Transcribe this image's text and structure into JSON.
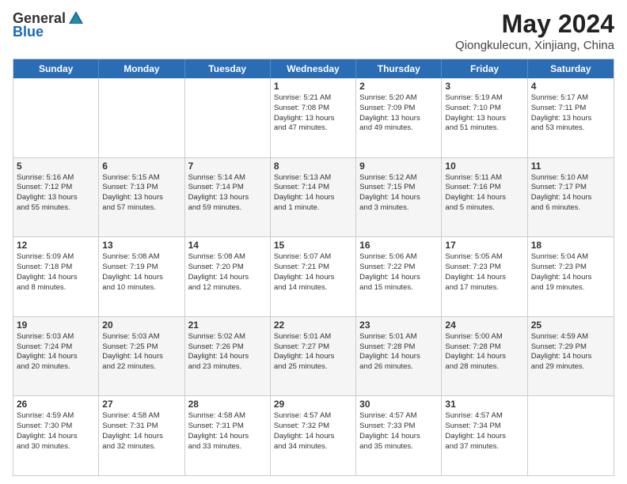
{
  "header": {
    "logo_general": "General",
    "logo_blue": "Blue",
    "title": "May 2024",
    "subtitle": "Qiongkulecun, Xinjiang, China"
  },
  "weekdays": [
    "Sunday",
    "Monday",
    "Tuesday",
    "Wednesday",
    "Thursday",
    "Friday",
    "Saturday"
  ],
  "rows": [
    [
      {
        "day": "",
        "lines": []
      },
      {
        "day": "",
        "lines": []
      },
      {
        "day": "",
        "lines": []
      },
      {
        "day": "1",
        "lines": [
          "Sunrise: 5:21 AM",
          "Sunset: 7:08 PM",
          "Daylight: 13 hours",
          "and 47 minutes."
        ]
      },
      {
        "day": "2",
        "lines": [
          "Sunrise: 5:20 AM",
          "Sunset: 7:09 PM",
          "Daylight: 13 hours",
          "and 49 minutes."
        ]
      },
      {
        "day": "3",
        "lines": [
          "Sunrise: 5:19 AM",
          "Sunset: 7:10 PM",
          "Daylight: 13 hours",
          "and 51 minutes."
        ]
      },
      {
        "day": "4",
        "lines": [
          "Sunrise: 5:17 AM",
          "Sunset: 7:11 PM",
          "Daylight: 13 hours",
          "and 53 minutes."
        ]
      }
    ],
    [
      {
        "day": "5",
        "lines": [
          "Sunrise: 5:16 AM",
          "Sunset: 7:12 PM",
          "Daylight: 13 hours",
          "and 55 minutes."
        ]
      },
      {
        "day": "6",
        "lines": [
          "Sunrise: 5:15 AM",
          "Sunset: 7:13 PM",
          "Daylight: 13 hours",
          "and 57 minutes."
        ]
      },
      {
        "day": "7",
        "lines": [
          "Sunrise: 5:14 AM",
          "Sunset: 7:14 PM",
          "Daylight: 13 hours",
          "and 59 minutes."
        ]
      },
      {
        "day": "8",
        "lines": [
          "Sunrise: 5:13 AM",
          "Sunset: 7:14 PM",
          "Daylight: 14 hours",
          "and 1 minute."
        ]
      },
      {
        "day": "9",
        "lines": [
          "Sunrise: 5:12 AM",
          "Sunset: 7:15 PM",
          "Daylight: 14 hours",
          "and 3 minutes."
        ]
      },
      {
        "day": "10",
        "lines": [
          "Sunrise: 5:11 AM",
          "Sunset: 7:16 PM",
          "Daylight: 14 hours",
          "and 5 minutes."
        ]
      },
      {
        "day": "11",
        "lines": [
          "Sunrise: 5:10 AM",
          "Sunset: 7:17 PM",
          "Daylight: 14 hours",
          "and 6 minutes."
        ]
      }
    ],
    [
      {
        "day": "12",
        "lines": [
          "Sunrise: 5:09 AM",
          "Sunset: 7:18 PM",
          "Daylight: 14 hours",
          "and 8 minutes."
        ]
      },
      {
        "day": "13",
        "lines": [
          "Sunrise: 5:08 AM",
          "Sunset: 7:19 PM",
          "Daylight: 14 hours",
          "and 10 minutes."
        ]
      },
      {
        "day": "14",
        "lines": [
          "Sunrise: 5:08 AM",
          "Sunset: 7:20 PM",
          "Daylight: 14 hours",
          "and 12 minutes."
        ]
      },
      {
        "day": "15",
        "lines": [
          "Sunrise: 5:07 AM",
          "Sunset: 7:21 PM",
          "Daylight: 14 hours",
          "and 14 minutes."
        ]
      },
      {
        "day": "16",
        "lines": [
          "Sunrise: 5:06 AM",
          "Sunset: 7:22 PM",
          "Daylight: 14 hours",
          "and 15 minutes."
        ]
      },
      {
        "day": "17",
        "lines": [
          "Sunrise: 5:05 AM",
          "Sunset: 7:23 PM",
          "Daylight: 14 hours",
          "and 17 minutes."
        ]
      },
      {
        "day": "18",
        "lines": [
          "Sunrise: 5:04 AM",
          "Sunset: 7:23 PM",
          "Daylight: 14 hours",
          "and 19 minutes."
        ]
      }
    ],
    [
      {
        "day": "19",
        "lines": [
          "Sunrise: 5:03 AM",
          "Sunset: 7:24 PM",
          "Daylight: 14 hours",
          "and 20 minutes."
        ]
      },
      {
        "day": "20",
        "lines": [
          "Sunrise: 5:03 AM",
          "Sunset: 7:25 PM",
          "Daylight: 14 hours",
          "and 22 minutes."
        ]
      },
      {
        "day": "21",
        "lines": [
          "Sunrise: 5:02 AM",
          "Sunset: 7:26 PM",
          "Daylight: 14 hours",
          "and 23 minutes."
        ]
      },
      {
        "day": "22",
        "lines": [
          "Sunrise: 5:01 AM",
          "Sunset: 7:27 PM",
          "Daylight: 14 hours",
          "and 25 minutes."
        ]
      },
      {
        "day": "23",
        "lines": [
          "Sunrise: 5:01 AM",
          "Sunset: 7:28 PM",
          "Daylight: 14 hours",
          "and 26 minutes."
        ]
      },
      {
        "day": "24",
        "lines": [
          "Sunrise: 5:00 AM",
          "Sunset: 7:28 PM",
          "Daylight: 14 hours",
          "and 28 minutes."
        ]
      },
      {
        "day": "25",
        "lines": [
          "Sunrise: 4:59 AM",
          "Sunset: 7:29 PM",
          "Daylight: 14 hours",
          "and 29 minutes."
        ]
      }
    ],
    [
      {
        "day": "26",
        "lines": [
          "Sunrise: 4:59 AM",
          "Sunset: 7:30 PM",
          "Daylight: 14 hours",
          "and 30 minutes."
        ]
      },
      {
        "day": "27",
        "lines": [
          "Sunrise: 4:58 AM",
          "Sunset: 7:31 PM",
          "Daylight: 14 hours",
          "and 32 minutes."
        ]
      },
      {
        "day": "28",
        "lines": [
          "Sunrise: 4:58 AM",
          "Sunset: 7:31 PM",
          "Daylight: 14 hours",
          "and 33 minutes."
        ]
      },
      {
        "day": "29",
        "lines": [
          "Sunrise: 4:57 AM",
          "Sunset: 7:32 PM",
          "Daylight: 14 hours",
          "and 34 minutes."
        ]
      },
      {
        "day": "30",
        "lines": [
          "Sunrise: 4:57 AM",
          "Sunset: 7:33 PM",
          "Daylight: 14 hours",
          "and 35 minutes."
        ]
      },
      {
        "day": "31",
        "lines": [
          "Sunrise: 4:57 AM",
          "Sunset: 7:34 PM",
          "Daylight: 14 hours",
          "and 37 minutes."
        ]
      },
      {
        "day": "",
        "lines": []
      }
    ]
  ]
}
